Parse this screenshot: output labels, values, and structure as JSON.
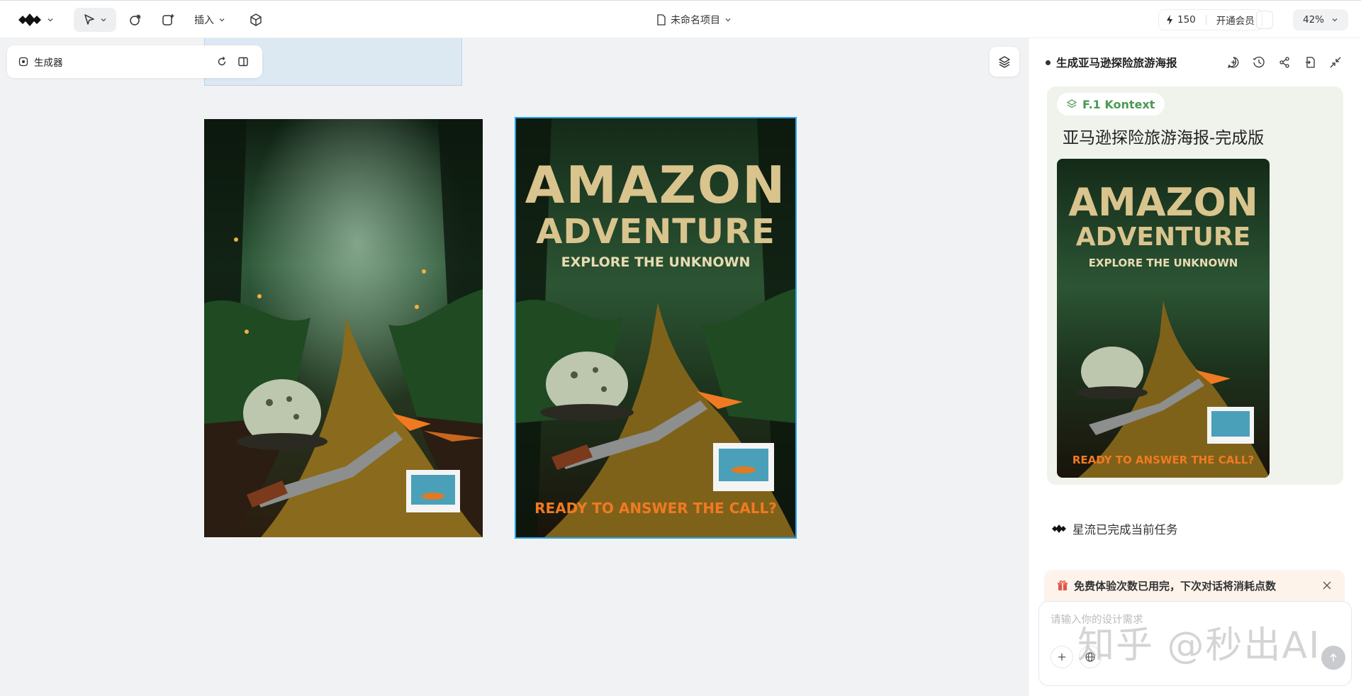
{
  "toolbar": {
    "insert_label": "插入",
    "project_name": "未命名项目",
    "credits": "150",
    "membership_label": "开通会员",
    "zoom": "42%"
  },
  "canvas": {
    "generator_label": "生成器"
  },
  "posters": {
    "title_line1": "AMAZON",
    "title_line2": "ADVENTURE",
    "subtitle": "EXPLORE THE UNKNOWN",
    "cta": "READY TO ANSWER THE CALL?"
  },
  "chat": {
    "title": "生成亚马逊探险旅游海报",
    "model": "F.1 Kontext",
    "result_title": "亚马逊探险旅游海报-完成版",
    "task_done": "星流已完成当前任务",
    "notice": "免费体验次数已用完，下次对话将消耗点数",
    "input_placeholder": "请输入你的设计需求"
  },
  "watermark": "知乎 @秒出AI",
  "colors": {
    "accent_blue": "#27a3e8",
    "model_green": "#4a9a52",
    "poster_title": "#d9c48e",
    "poster_cta": "#f07a22"
  }
}
